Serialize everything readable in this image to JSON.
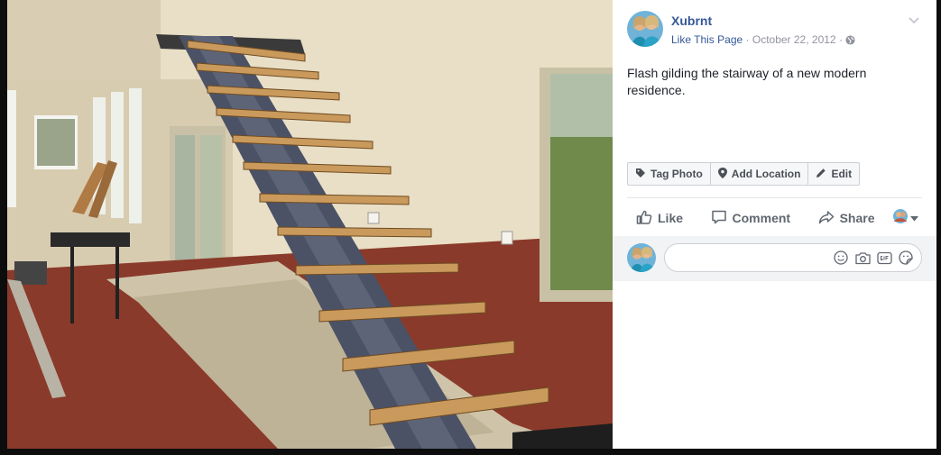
{
  "post": {
    "page_name": "Xubrnt",
    "like_page_label": "Like This Page",
    "separator": "·",
    "date": "October 22, 2012",
    "caption": "Flash gilding the stairway of a new modern residence."
  },
  "photo_actions": [
    {
      "label": "Tag Photo",
      "icon": "tag-icon"
    },
    {
      "label": "Add Location",
      "icon": "location-pin-icon"
    },
    {
      "label": "Edit",
      "icon": "pencil-icon"
    }
  ],
  "actions": {
    "like_label": "Like",
    "comment_label": "Comment",
    "share_label": "Share"
  },
  "comment_box": {
    "placeholder": "",
    "tools": [
      "emoji-icon",
      "camera-icon",
      "gif-icon",
      "sticker-icon"
    ]
  },
  "colors": {
    "link_blue": "#365899",
    "meta_gray": "#90949c",
    "action_gray": "#606770",
    "comment_bg": "#f2f3f5"
  }
}
